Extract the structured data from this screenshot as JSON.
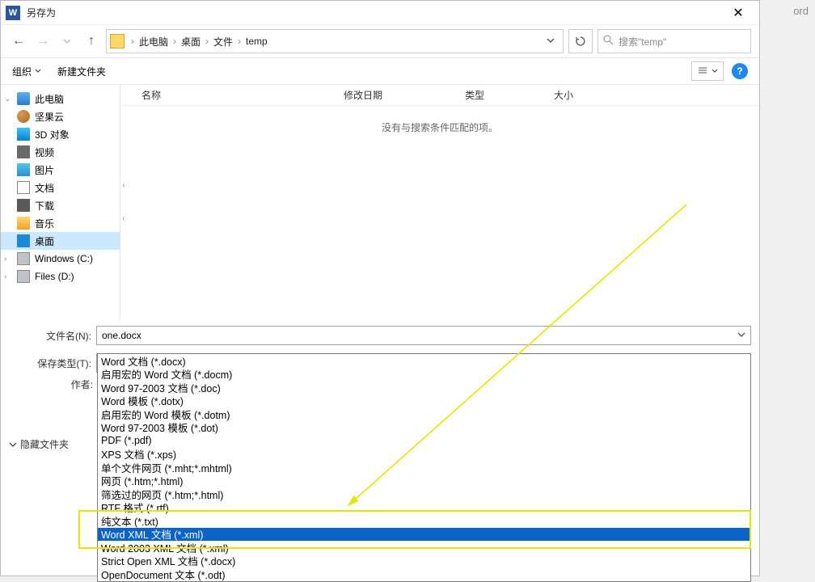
{
  "window": {
    "title": "另存为",
    "behind_tab": "ord"
  },
  "breadcrumb": {
    "root": "此电脑",
    "p1": "桌面",
    "p2": "文件",
    "p3": "temp"
  },
  "search": {
    "placeholder": "搜索\"temp\""
  },
  "toolbar": {
    "organize": "组织",
    "newfolder": "新建文件夹"
  },
  "sidebar": {
    "items": [
      {
        "label": "此电脑",
        "iconClass": "ico-pc"
      },
      {
        "label": "坚果云",
        "iconClass": "ico-cloud"
      },
      {
        "label": "3D 对象",
        "iconClass": "ico-3d"
      },
      {
        "label": "视频",
        "iconClass": "ico-video"
      },
      {
        "label": "图片",
        "iconClass": "ico-pic"
      },
      {
        "label": "文档",
        "iconClass": "ico-doc"
      },
      {
        "label": "下载",
        "iconClass": "ico-dl"
      },
      {
        "label": "音乐",
        "iconClass": "ico-music"
      },
      {
        "label": "桌面",
        "iconClass": "ico-desktop"
      },
      {
        "label": "Windows (C:)",
        "iconClass": "ico-drive"
      },
      {
        "label": "Files (D:)",
        "iconClass": "ico-drive"
      }
    ]
  },
  "columns": {
    "c0": "名称",
    "c1": "修改日期",
    "c2": "类型",
    "c3": "大小"
  },
  "empty": "没有与搜索条件匹配的项。",
  "labels": {
    "filename": "文件名(N):",
    "filetype": "保存类型(T):",
    "authors": "作者:"
  },
  "filename": "one.docx",
  "filetype_selected": "Word 文档 (*.docx)",
  "hide_folders": "隐藏文件夹",
  "options": [
    "Word 文档 (*.docx)",
    "启用宏的 Word 文档 (*.docm)",
    "Word 97-2003 文档 (*.doc)",
    "Word 模板 (*.dotx)",
    "启用宏的 Word 模板 (*.dotm)",
    "Word 97-2003 模板 (*.dot)",
    "PDF (*.pdf)",
    "XPS 文档 (*.xps)",
    "单个文件网页 (*.mht;*.mhtml)",
    "网页 (*.htm;*.html)",
    "筛选过的网页 (*.htm;*.html)",
    "RTF 格式 (*.rtf)",
    "纯文本 (*.txt)",
    "Word XML 文档 (*.xml)",
    "Word 2003 XML 文档 (*.xml)",
    "Strict Open XML 文档 (*.docx)",
    "OpenDocument 文本 (*.odt)"
  ]
}
